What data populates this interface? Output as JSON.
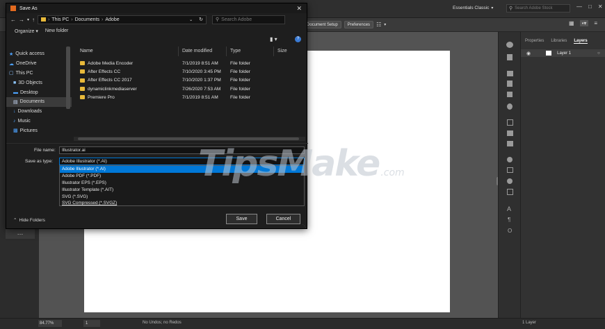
{
  "illustrator": {
    "workspace": "Essentials Classic",
    "search_placeholder": "Search Adobe Stock",
    "document_setup": "Document Setup",
    "preferences": "Preferences",
    "panel_tabs": [
      "Properties",
      "Libraries",
      "Layers"
    ],
    "layer_name": "Layer 1",
    "zoom": "84.77%",
    "page_number": "1",
    "status_text": "No Undos; no Redos",
    "layers_count": "1 Layer",
    "colors": {
      "artboard": "#ffffff",
      "canvas": "#535353",
      "ui_dark": "#323232",
      "accent": "#0078d7"
    }
  },
  "dialog": {
    "title": "Save As",
    "path": [
      "This PC",
      "Documents",
      "Adobe"
    ],
    "search_placeholder": "Search Adobe",
    "organize": "Organize",
    "new_folder": "New folder",
    "nav": [
      {
        "label": "Quick access",
        "icon": "star-icon"
      },
      {
        "label": "OneDrive",
        "icon": "cloud-icon"
      },
      {
        "label": "This PC",
        "icon": "computer-icon"
      },
      {
        "label": "3D Objects",
        "icon": "cube-icon"
      },
      {
        "label": "Desktop",
        "icon": "desktop-icon"
      },
      {
        "label": "Documents",
        "icon": "document-icon"
      },
      {
        "label": "Downloads",
        "icon": "download-icon"
      },
      {
        "label": "Music",
        "icon": "music-icon"
      },
      {
        "label": "Pictures",
        "icon": "picture-icon"
      }
    ],
    "columns": [
      "Name",
      "Date modified",
      "Type",
      "Size"
    ],
    "files": [
      {
        "name": "Adobe Media Encoder",
        "date": "7/1/2019 8:51 AM",
        "type": "File folder"
      },
      {
        "name": "After Effects CC",
        "date": "7/10/2020 3:45 PM",
        "type": "File folder"
      },
      {
        "name": "After Effects CC 2017",
        "date": "7/10/2020 1:37 PM",
        "type": "File folder"
      },
      {
        "name": "dynamiclinkmediaserver",
        "date": "7/26/2020 7:53 AM",
        "type": "File folder"
      },
      {
        "name": "Premiere Pro",
        "date": "7/1/2019 8:51 AM",
        "type": "File folder"
      }
    ],
    "file_name_label": "File name:",
    "file_name_value": "Illustrator.ai",
    "save_as_type_label": "Save as type:",
    "save_as_type_value": "Adobe Illustrator (*.AI)",
    "type_options": [
      "Adobe Illustrator (*.AI)",
      "Adobe PDF (*.PDF)",
      "Illustrator EPS (*.EPS)",
      "Illustrator Template (*.AIT)",
      "SVG (*.SVG)",
      "SVG Compressed (*.SVGZ)"
    ],
    "selected_type_index": 0,
    "hide_folders": "Hide Folders",
    "save": "Save",
    "cancel": "Cancel"
  },
  "watermark": {
    "main": "TipsMake",
    "suffix": ".com"
  }
}
